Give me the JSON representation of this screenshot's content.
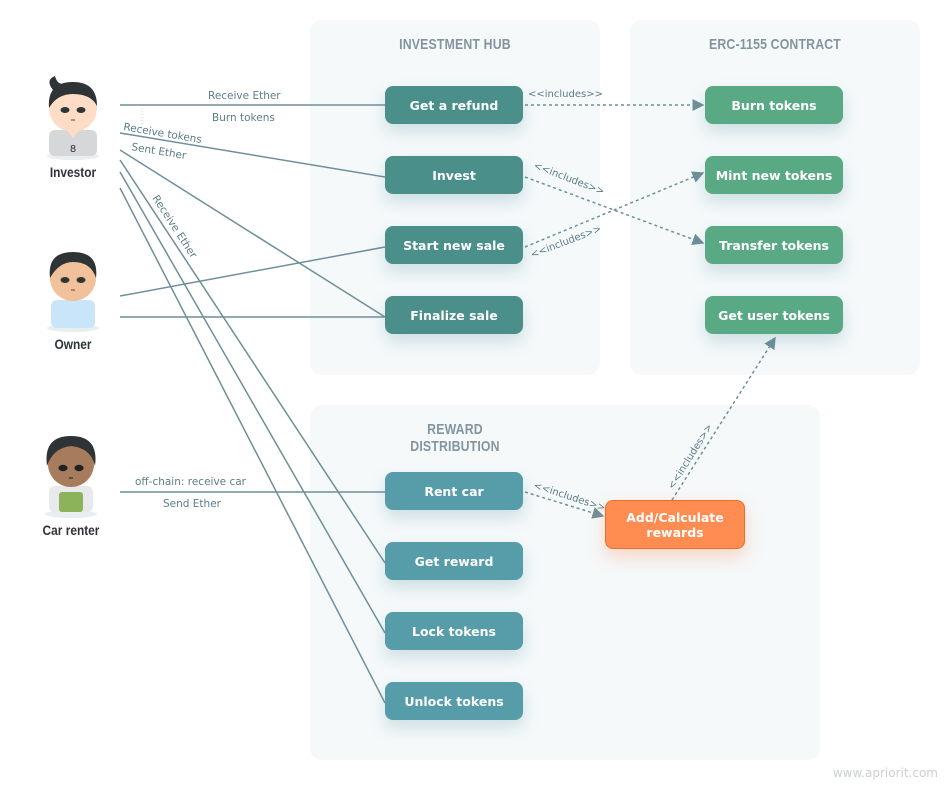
{
  "panels": {
    "investment_hub": {
      "title": "INVESTMENT HUB"
    },
    "erc1155": {
      "title": "ERC-1155 CONTRACT"
    },
    "reward": {
      "title": "REWARD DISTRIBUTION"
    }
  },
  "actors": [
    {
      "id": "investor",
      "label": "Investor"
    },
    {
      "id": "owner",
      "label": "Owner"
    },
    {
      "id": "car_renter",
      "label": "Car renter"
    }
  ],
  "use_cases": {
    "hub": [
      "Get a refund",
      "Invest",
      "Start new sale",
      "Finalize sale"
    ],
    "erc": [
      "Burn tokens",
      "Mint new tokens",
      "Transfer tokens",
      "Get user tokens"
    ],
    "reward": [
      "Rent car",
      "Get reward",
      "Lock tokens",
      "Unlock tokens"
    ],
    "calc": "Add/Calculate rewards"
  },
  "edge_labels": {
    "receive_ether": "Receive Ether",
    "burn_tokens": "Burn tokens",
    "receive_tokens": "Receive tokens",
    "sent_ether": "Sent Ether",
    "receive_ether_diag": "Receive Ether",
    "offchain": "off-chain: receive car",
    "send_ether": "Send Ether",
    "includes": "<<includes>>"
  },
  "colors": {
    "hub": "#4a8f89",
    "erc": "#5aa985",
    "reward": "#569ca9",
    "calc": "#ff8d52",
    "line": "#6e8f98"
  },
  "watermark": "www.apriorit.com"
}
